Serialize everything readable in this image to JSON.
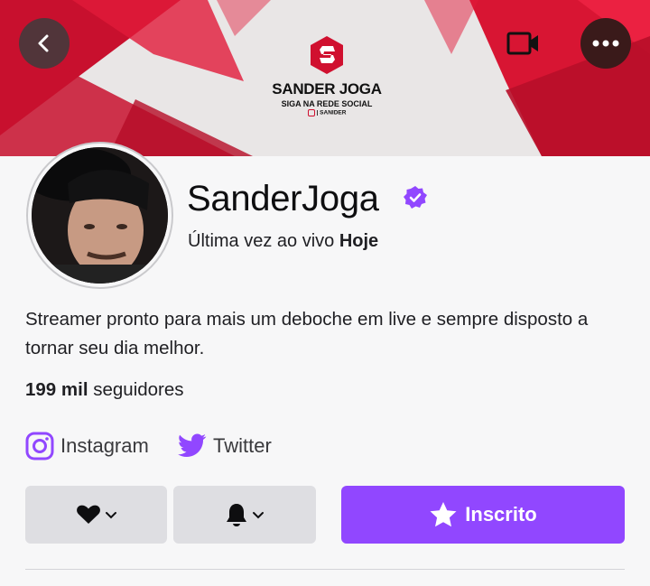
{
  "banner": {
    "title": "SANDER JOGA",
    "subtitle": "SIGA NA REDE SOCIAL",
    "handle": "| SANIDER"
  },
  "header": {
    "back_icon": "chevron-left-icon",
    "camera_icon": "video-camera-icon",
    "more_icon": "ellipsis-icon"
  },
  "profile": {
    "name": "SanderJoga",
    "verified_icon": "verified-badge-icon",
    "last_live_prefix": "Última vez ao vivo",
    "last_live_value": "Hoje",
    "bio": "Streamer pronto para mais um deboche em live e sempre disposto a tornar seu dia melhor.",
    "followers_count": "199 mil",
    "followers_label": "seguidores"
  },
  "social": [
    {
      "label": "Instagram",
      "icon": "instagram-icon"
    },
    {
      "label": "Twitter",
      "icon": "twitter-icon"
    }
  ],
  "actions": {
    "follow_icon": "heart-icon",
    "notify_icon": "bell-icon",
    "subscribe_label": "Inscrito",
    "subscribe_icon": "star-icon"
  },
  "colors": {
    "accent": "#9147ff",
    "banner_red": "#d4102c",
    "background": "#f7f7f8"
  }
}
